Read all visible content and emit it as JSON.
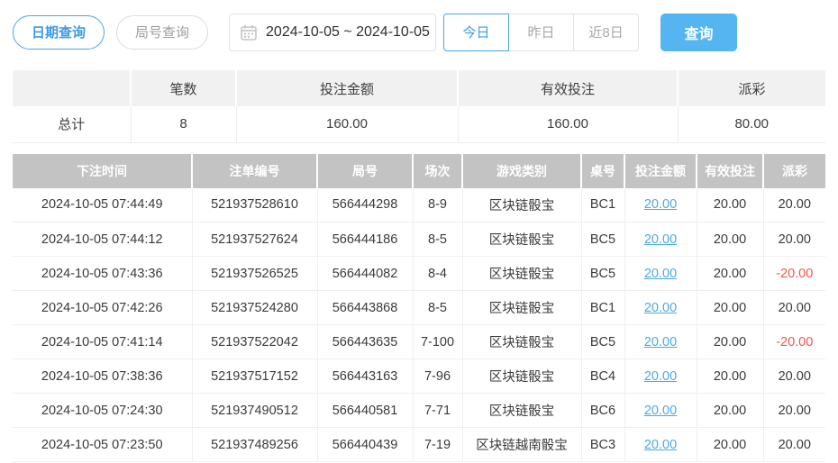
{
  "toolbar": {
    "date_query_label": "日期查询",
    "round_query_label": "局号查询",
    "date_range_value": "2024-10-05 ~ 2024-10-05",
    "quick_buttons": [
      {
        "label": "今日",
        "active": true
      },
      {
        "label": "昨日",
        "active": false
      },
      {
        "label": "近8日",
        "active": false
      }
    ],
    "search_label": "查询"
  },
  "summary": {
    "columns": [
      "",
      "笔数",
      "投注金额",
      "有效投注",
      "派彩"
    ],
    "row": {
      "label": "总计",
      "count": "8",
      "bet_amount": "160.00",
      "valid_bet": "160.00",
      "payout": "80.00"
    }
  },
  "records": {
    "columns": [
      "下注时间",
      "注单编号",
      "局号",
      "场次",
      "游戏类别",
      "桌号",
      "投注金额",
      "有效投注",
      "派彩"
    ],
    "rows": [
      {
        "time": "2024-10-05 07:44:49",
        "order_no": "521937528610",
        "round_no": "566444298",
        "session": "8-9",
        "game": "区块链骰宝",
        "table_no": "BC1",
        "bet": "20.00",
        "valid": "20.00",
        "payout": "20.00",
        "payout_negative": false
      },
      {
        "time": "2024-10-05 07:44:12",
        "order_no": "521937527624",
        "round_no": "566444186",
        "session": "8-5",
        "game": "区块链骰宝",
        "table_no": "BC5",
        "bet": "20.00",
        "valid": "20.00",
        "payout": "20.00",
        "payout_negative": false
      },
      {
        "time": "2024-10-05 07:43:36",
        "order_no": "521937526525",
        "round_no": "566444082",
        "session": "8-4",
        "game": "区块链骰宝",
        "table_no": "BC5",
        "bet": "20.00",
        "valid": "20.00",
        "payout": "-20.00",
        "payout_negative": true
      },
      {
        "time": "2024-10-05 07:42:26",
        "order_no": "521937524280",
        "round_no": "566443868",
        "session": "8-5",
        "game": "区块链骰宝",
        "table_no": "BC1",
        "bet": "20.00",
        "valid": "20.00",
        "payout": "20.00",
        "payout_negative": false
      },
      {
        "time": "2024-10-05 07:41:14",
        "order_no": "521937522042",
        "round_no": "566443635",
        "session": "7-100",
        "game": "区块链骰宝",
        "table_no": "BC5",
        "bet": "20.00",
        "valid": "20.00",
        "payout": "-20.00",
        "payout_negative": true
      },
      {
        "time": "2024-10-05 07:38:36",
        "order_no": "521937517152",
        "round_no": "566443163",
        "session": "7-96",
        "game": "区块链骰宝",
        "table_no": "BC4",
        "bet": "20.00",
        "valid": "20.00",
        "payout": "20.00",
        "payout_negative": false
      },
      {
        "time": "2024-10-05 07:24:30",
        "order_no": "521937490512",
        "round_no": "566440581",
        "session": "7-71",
        "game": "区块链骰宝",
        "table_no": "BC6",
        "bet": "20.00",
        "valid": "20.00",
        "payout": "20.00",
        "payout_negative": false
      },
      {
        "time": "2024-10-05 07:23:50",
        "order_no": "521937489256",
        "round_no": "566440439",
        "session": "7-19",
        "game": "区块链越南骰宝",
        "table_no": "BC3",
        "bet": "20.00",
        "valid": "20.00",
        "payout": "20.00",
        "payout_negative": false
      }
    ]
  },
  "colors": {
    "accent_blue": "#4aa5e8",
    "search_button_blue": "#55b5f1",
    "link_blue": "#4aa9e2",
    "negative_red": "#f2564d",
    "records_header_gray": "#c3c3c3",
    "summary_header_gray": "#f1f1f1"
  }
}
